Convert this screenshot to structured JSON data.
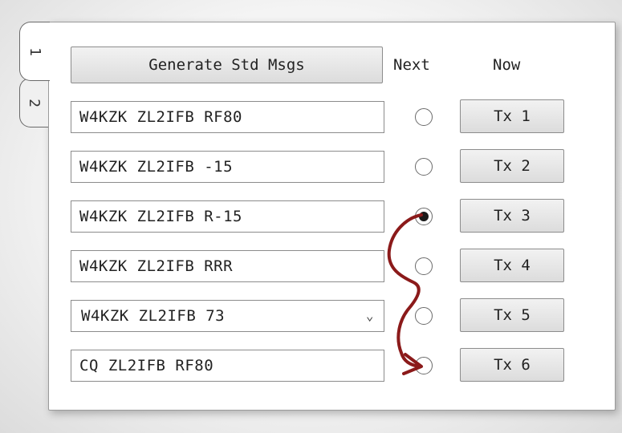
{
  "tabs": [
    {
      "label": "1",
      "active": true
    },
    {
      "label": "2",
      "active": false
    }
  ],
  "header": {
    "generate_label": "Generate Std Msgs",
    "next_label": "Next",
    "now_label": "Now"
  },
  "rows": [
    {
      "message": "W4KZK ZL2IFB RF80",
      "next_selected": false,
      "tx_label": "Tx 1"
    },
    {
      "message": "W4KZK ZL2IFB -15",
      "next_selected": false,
      "tx_label": "Tx 2"
    },
    {
      "message": "W4KZK ZL2IFB R-15",
      "next_selected": true,
      "tx_label": "Tx 3"
    },
    {
      "message": "W4KZK ZL2IFB RRR",
      "next_selected": false,
      "tx_label": "Tx 4"
    },
    {
      "message": "W4KZK ZL2IFB 73",
      "next_selected": false,
      "tx_label": "Tx 5",
      "dropdown": true
    },
    {
      "message": "CQ ZL2IFB RF80",
      "next_selected": false,
      "tx_label": "Tx 6"
    }
  ],
  "annotation": {
    "arrow_color": "#8b1a1a"
  }
}
